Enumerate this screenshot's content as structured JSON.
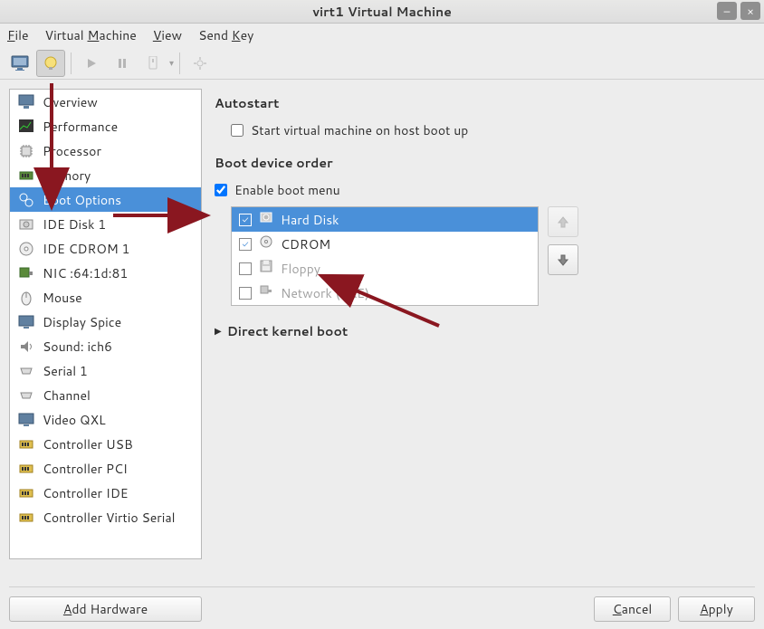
{
  "window": {
    "title": "virt1 Virtual Machine"
  },
  "menu": {
    "file": "File",
    "vm": "Virtual Machine",
    "view": "View",
    "sendkey": "Send Key"
  },
  "sidebar": {
    "items": [
      {
        "label": "Overview"
      },
      {
        "label": "Performance"
      },
      {
        "label": "Processor"
      },
      {
        "label": "Memory"
      },
      {
        "label": "Boot Options"
      },
      {
        "label": "IDE Disk 1"
      },
      {
        "label": "IDE CDROM 1"
      },
      {
        "label": "NIC :64:1d:81"
      },
      {
        "label": "Mouse"
      },
      {
        "label": "Display Spice"
      },
      {
        "label": "Sound: ich6"
      },
      {
        "label": "Serial 1"
      },
      {
        "label": "Channel"
      },
      {
        "label": "Video QXL"
      },
      {
        "label": "Controller USB"
      },
      {
        "label": "Controller PCI"
      },
      {
        "label": "Controller IDE"
      },
      {
        "label": "Controller Virtio Serial"
      }
    ]
  },
  "main": {
    "autostart": {
      "heading": "Autostart",
      "label": "Start virtual machine on host boot up"
    },
    "bootorder": {
      "heading": "Boot device order",
      "enable": "Enable boot menu",
      "items": [
        {
          "label": "Hard Disk",
          "checked": true,
          "selected": true,
          "enabled": true
        },
        {
          "label": "CDROM",
          "checked": true,
          "selected": false,
          "enabled": true
        },
        {
          "label": "Floppy",
          "checked": false,
          "selected": false,
          "enabled": false
        },
        {
          "label": "Network (PXE)",
          "checked": false,
          "selected": false,
          "enabled": false
        }
      ]
    },
    "kernel": {
      "heading": "Direct kernel boot"
    }
  },
  "buttons": {
    "add": "Add Hardware",
    "cancel": "Cancel",
    "apply": "Apply"
  }
}
